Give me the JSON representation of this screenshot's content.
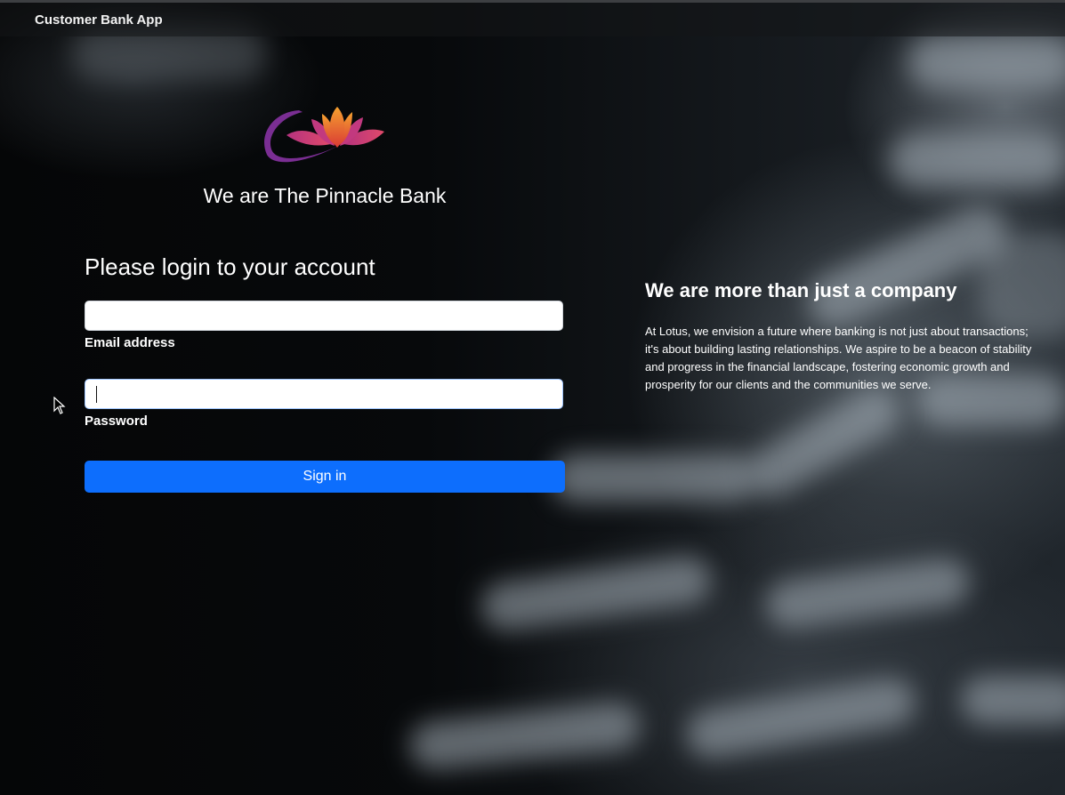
{
  "window": {
    "title": "Customer Bank App"
  },
  "branding": {
    "logo_icon": "lotus-logo-icon",
    "title": "We are The Pinnacle Bank"
  },
  "login": {
    "heading": "Please login to your account",
    "email": {
      "label": "Email address",
      "value": "",
      "placeholder": ""
    },
    "password": {
      "label": "Password",
      "value": "",
      "placeholder": ""
    },
    "submit_label": "Sign in"
  },
  "about": {
    "heading": "We are more than just a company",
    "text": "At Lotus, we envision a future where banking is not just about transactions; it's about building lasting relationships. We aspire to be a beacon of stability and progress in the financial landscape, fostering economic growth and prosperity for our clients and the communities we serve."
  },
  "colors": {
    "primary_button": "#0d6efd",
    "background": "#050607",
    "text": "#ffffff"
  }
}
